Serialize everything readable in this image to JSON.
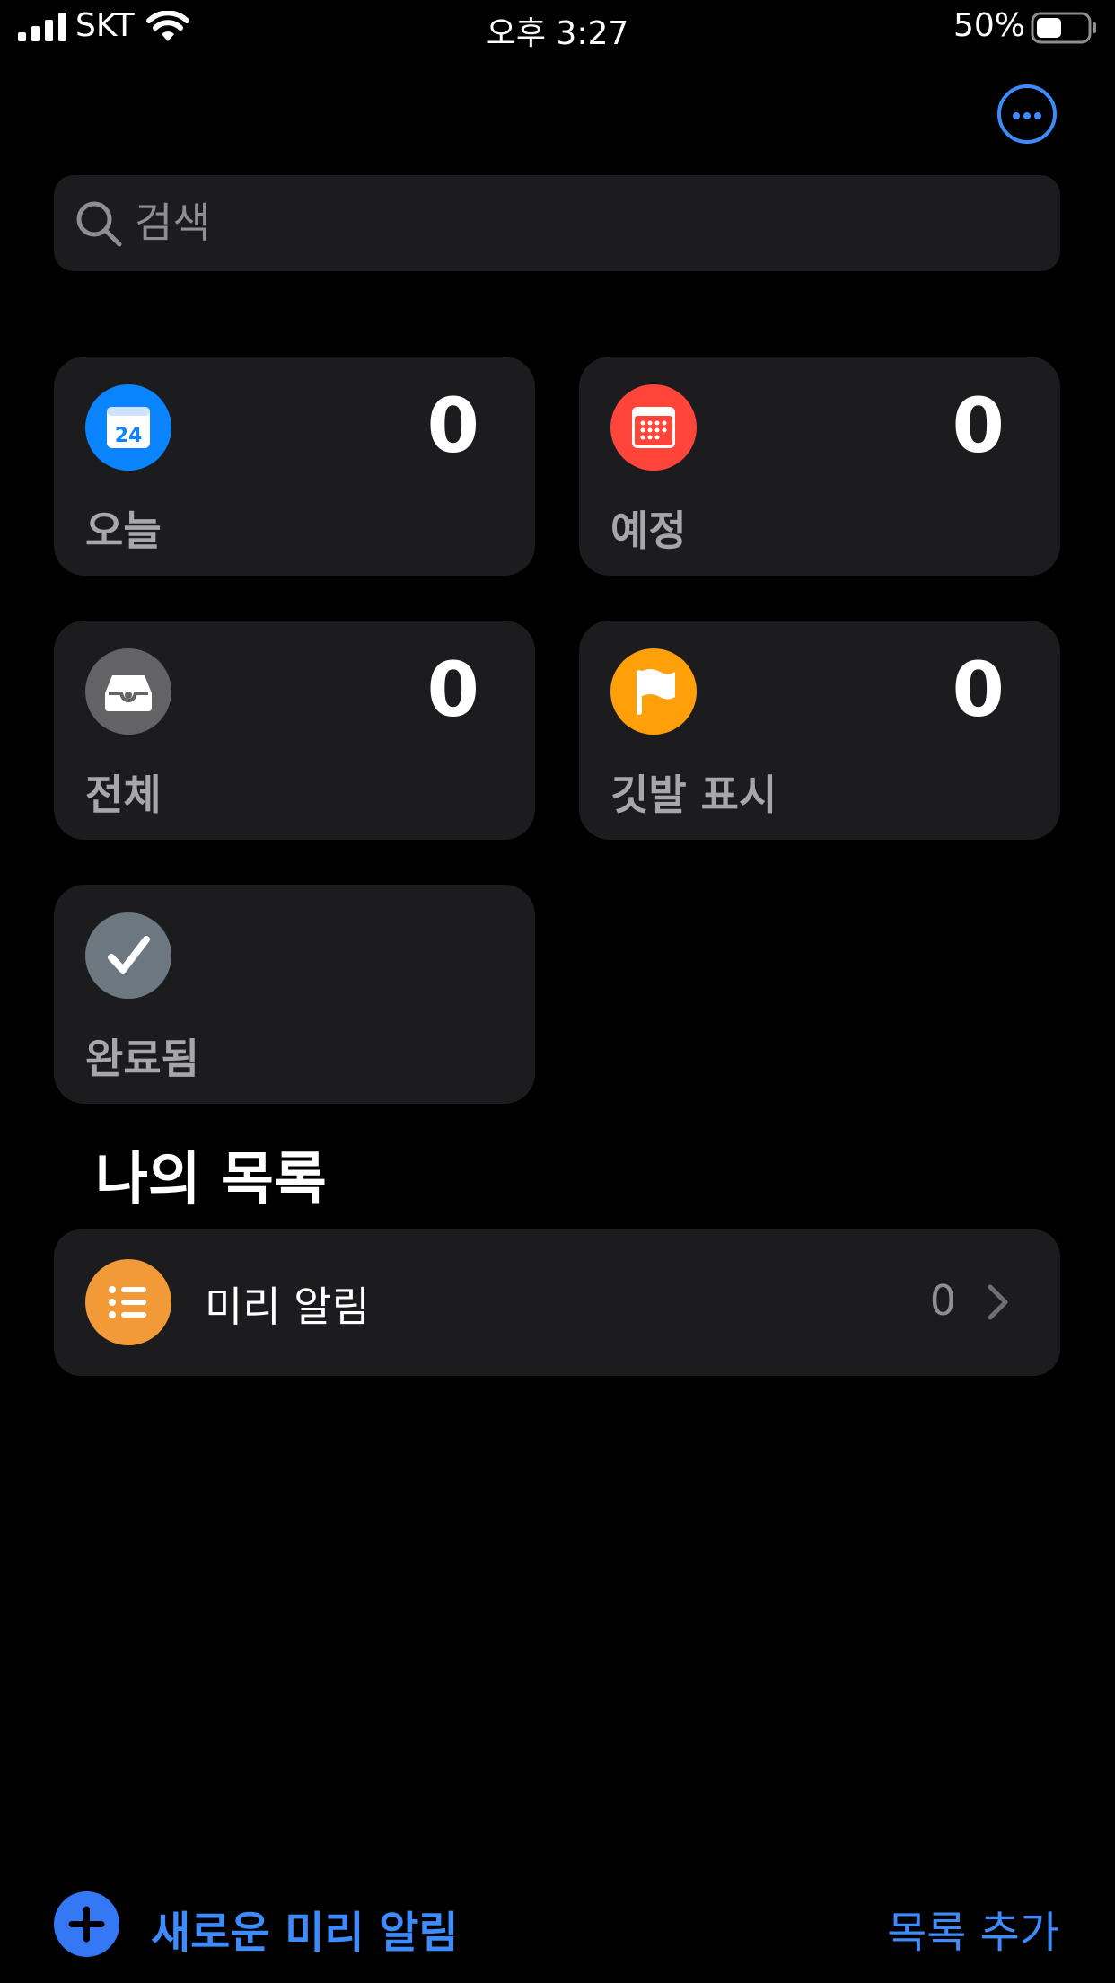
{
  "status_bar": {
    "carrier": "SKT",
    "time": "오후 3:27",
    "battery_percent": "50%",
    "battery_level": 0.5,
    "signal_icon": "cellular-signal-icon",
    "wifi_icon": "wifi-icon"
  },
  "header": {
    "more_icon": "ellipsis-circle-icon"
  },
  "search": {
    "placeholder": "검색",
    "value": ""
  },
  "smart_lists": [
    {
      "label": "오늘",
      "count": "0",
      "icon": "calendar-today-icon",
      "icon_text": "24",
      "color": "#0a84ff"
    },
    {
      "label": "예정",
      "count": "0",
      "icon": "calendar-grid-icon",
      "color": "#ff453a"
    },
    {
      "label": "전체",
      "count": "0",
      "icon": "tray-icon",
      "color": "#636366"
    },
    {
      "label": "깃발 표시",
      "count": "0",
      "icon": "flag-icon",
      "color": "#ff9f0a"
    },
    {
      "label": "완료됨",
      "icon": "checkmark-icon",
      "color": "#6c7780"
    }
  ],
  "my_lists": {
    "title": "나의 목록",
    "items": [
      {
        "label": "미리 알림",
        "count": "0",
        "icon": "list-bullet-icon",
        "color": "#f19a37"
      }
    ]
  },
  "toolbar": {
    "new_reminder_label": "새로운 미리 알림",
    "add_list_label": "목록 추가",
    "accent_color": "#3d8bfd"
  }
}
